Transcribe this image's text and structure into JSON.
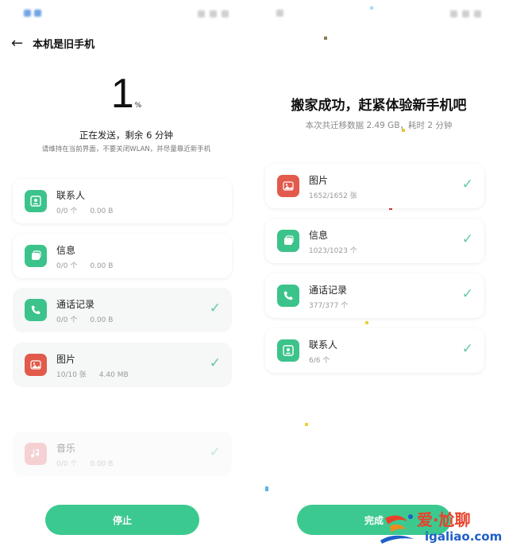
{
  "left": {
    "title": "本机是旧手机",
    "progress_value": "1",
    "progress_unit": "%",
    "status": "正在发送，剩余 6 分钟",
    "hint": "请维持在当前界面，不要关闭WLAN，并尽量靠近新手机",
    "items": [
      {
        "title": "联系人",
        "count": "0/0 个",
        "size": "0.00 B",
        "icon": "contact-icon"
      },
      {
        "title": "信息",
        "count": "0/0 个",
        "size": "0.00 B",
        "icon": "message-icon"
      },
      {
        "title": "通话记录",
        "count": "0/0 个",
        "size": "0.00 B",
        "icon": "phone-icon"
      },
      {
        "title": "图片",
        "count": "10/10 张",
        "size": "4.40 MB",
        "icon": "picture-icon"
      },
      {
        "title": "音乐",
        "count": "0/0 个",
        "size": "0.00 B",
        "icon": "music-icon"
      }
    ],
    "stop_label": "停止"
  },
  "right": {
    "title": "搬家成功，赶紧体验新手机吧",
    "summary": "本次共迁移数据 2.49 GB，耗时 2 分钟",
    "items": [
      {
        "title": "图片",
        "count": "1652/1652 张",
        "icon": "picture-icon"
      },
      {
        "title": "信息",
        "count": "1023/1023 个",
        "icon": "message-icon"
      },
      {
        "title": "通话记录",
        "count": "377/377 个",
        "icon": "phone-icon"
      },
      {
        "title": "联系人",
        "count": "6/6 个",
        "icon": "contact-icon"
      }
    ],
    "done_label": "完成"
  },
  "watermark": {
    "brand": "爱·尬聊",
    "domain": "igaliao.com"
  },
  "colors": {
    "accent_green": "#3cc98f",
    "icon_green": "#3cc38b",
    "icon_red": "#e25a4b",
    "check": "#63c9a0"
  }
}
